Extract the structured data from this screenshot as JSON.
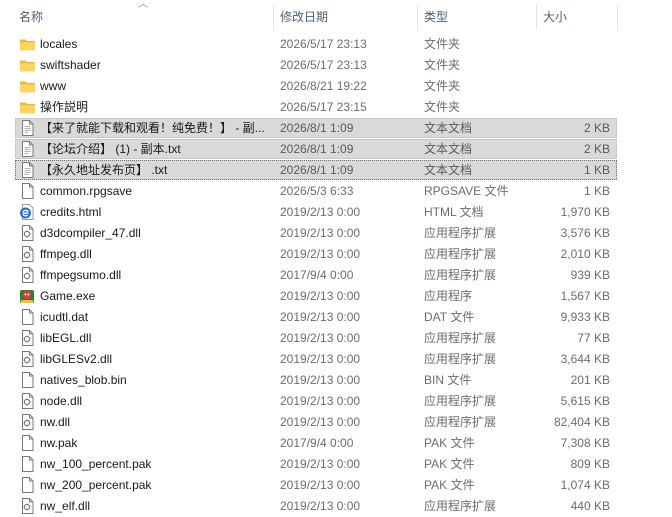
{
  "columns": {
    "name": "名称",
    "date": "修改日期",
    "type": "类型",
    "size": "大小"
  },
  "sort_icon": "sort-up-chevron-icon",
  "files": [
    {
      "icon": "folder-icon",
      "name": "locales",
      "date": "2026/5/17 23:13",
      "type": "文件夹",
      "size": ""
    },
    {
      "icon": "folder-icon",
      "name": "swiftshader",
      "date": "2026/5/17 23:13",
      "type": "文件夹",
      "size": ""
    },
    {
      "icon": "folder-icon",
      "name": "www",
      "date": "2026/8/21 19:22",
      "type": "文件夹",
      "size": ""
    },
    {
      "icon": "folder-icon",
      "name": "操作説明",
      "date": "2026/5/17 23:15",
      "type": "文件夹",
      "size": ""
    },
    {
      "icon": "text-document-icon",
      "name": "【来了就能下载和观看！纯免费！】 - 副...",
      "date": "2026/8/1 1:09",
      "type": "文本文档",
      "size": "2 KB",
      "selected": true
    },
    {
      "icon": "text-document-icon",
      "name": "【论坛介绍】 (1) - 副本.txt",
      "date": "2026/8/1 1:09",
      "type": "文本文档",
      "size": "2 KB",
      "selected": true
    },
    {
      "icon": "text-document-icon",
      "name": "【永久地址发布页】 .txt",
      "date": "2026/8/1 1:09",
      "type": "文本文档",
      "size": "1 KB",
      "selected": true,
      "focused": true
    },
    {
      "icon": "file-icon",
      "name": "common.rpgsave",
      "date": "2026/5/3 6:33",
      "type": "RPGSAVE 文件",
      "size": "1 KB"
    },
    {
      "icon": "edge-html-icon",
      "name": "credits.html",
      "date": "2019/2/13 0:00",
      "type": "HTML 文档",
      "size": "1,970 KB"
    },
    {
      "icon": "dll-icon",
      "name": "d3dcompiler_47.dll",
      "date": "2019/2/13 0:00",
      "type": "应用程序扩展",
      "size": "3,576 KB"
    },
    {
      "icon": "dll-icon",
      "name": "ffmpeg.dll",
      "date": "2019/2/13 0:00",
      "type": "应用程序扩展",
      "size": "2,010 KB"
    },
    {
      "icon": "dll-icon",
      "name": "ffmpegsumo.dll",
      "date": "2017/9/4 0:00",
      "type": "应用程序扩展",
      "size": "939 KB"
    },
    {
      "icon": "game-exe-icon",
      "name": "Game.exe",
      "date": "2019/2/13 0:00",
      "type": "应用程序",
      "size": "1,567 KB"
    },
    {
      "icon": "file-icon",
      "name": "icudtl.dat",
      "date": "2019/2/13 0:00",
      "type": "DAT 文件",
      "size": "9,933 KB"
    },
    {
      "icon": "dll-icon",
      "name": "libEGL.dll",
      "date": "2019/2/13 0:00",
      "type": "应用程序扩展",
      "size": "77 KB"
    },
    {
      "icon": "dll-icon",
      "name": "libGLESv2.dll",
      "date": "2019/2/13 0:00",
      "type": "应用程序扩展",
      "size": "3,644 KB"
    },
    {
      "icon": "file-icon",
      "name": "natives_blob.bin",
      "date": "2019/2/13 0:00",
      "type": "BIN 文件",
      "size": "201 KB"
    },
    {
      "icon": "dll-icon",
      "name": "node.dll",
      "date": "2019/2/13 0:00",
      "type": "应用程序扩展",
      "size": "5,615 KB"
    },
    {
      "icon": "dll-icon",
      "name": "nw.dll",
      "date": "2019/2/13 0:00",
      "type": "应用程序扩展",
      "size": "82,404 KB"
    },
    {
      "icon": "file-icon",
      "name": "nw.pak",
      "date": "2017/9/4 0:00",
      "type": "PAK 文件",
      "size": "7,308 KB"
    },
    {
      "icon": "file-icon",
      "name": "nw_100_percent.pak",
      "date": "2019/2/13 0:00",
      "type": "PAK 文件",
      "size": "809 KB"
    },
    {
      "icon": "file-icon",
      "name": "nw_200_percent.pak",
      "date": "2019/2/13 0:00",
      "type": "PAK 文件",
      "size": "1,074 KB"
    },
    {
      "icon": "dll-icon",
      "name": "nw_elf.dll",
      "date": "2019/2/13 0:00",
      "type": "应用程序扩展",
      "size": "440 KB"
    }
  ]
}
